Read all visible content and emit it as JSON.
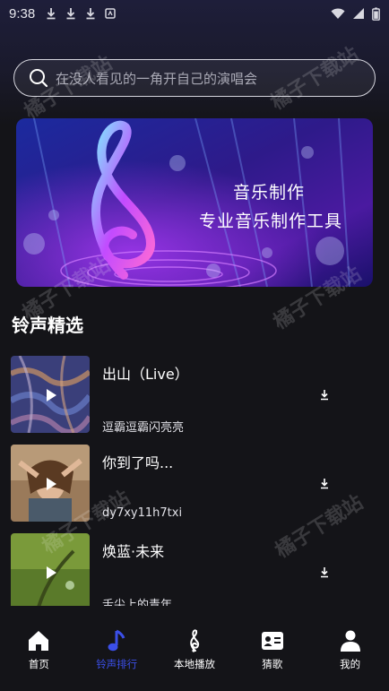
{
  "status_bar": {
    "time": "9:38",
    "left_icons": [
      "download-icon",
      "download-icon",
      "download-icon",
      "notification-icon"
    ],
    "right_icons": [
      "wifi-icon",
      "signal-icon",
      "battery-icon"
    ]
  },
  "search": {
    "placeholder": "在没人看见的一角开自己的演唱会"
  },
  "banner": {
    "title": "音乐制作",
    "subtitle": "专业音乐制作工具"
  },
  "section": {
    "title": "铃声精选"
  },
  "songs": [
    {
      "title": "出山（Live）",
      "artist": "逗霸逗霸闪亮亮"
    },
    {
      "title": "你到了吗...",
      "artist": "dy7xy11h7txi"
    },
    {
      "title": "焕蓝·未来",
      "artist": "舌尖上的青年"
    }
  ],
  "nav": [
    {
      "label": "首页",
      "icon": "home-icon",
      "active": false
    },
    {
      "label": "铃声排行",
      "icon": "music-note-icon",
      "active": true
    },
    {
      "label": "本地播放",
      "icon": "treble-clef-icon",
      "active": false
    },
    {
      "label": "猜歌",
      "icon": "id-card-icon",
      "active": false
    },
    {
      "label": "我的",
      "icon": "person-icon",
      "active": false
    }
  ],
  "watermark": "橘子下载站",
  "colors": {
    "background": "#141418",
    "accent": "#3b4fe8",
    "nav_text": "#ffffff"
  }
}
